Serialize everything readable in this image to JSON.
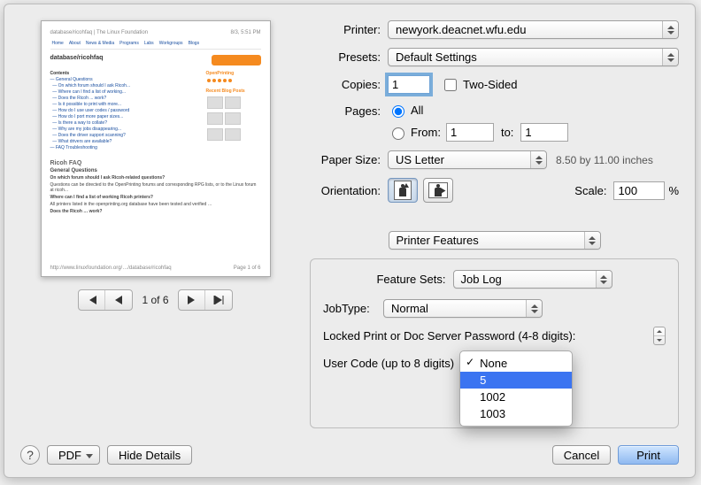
{
  "labels": {
    "printer": "Printer:",
    "presets": "Presets:",
    "copies": "Copies:",
    "two_sided": "Two-Sided",
    "pages": "Pages:",
    "all": "All",
    "from": "From:",
    "to": "to:",
    "paper_size": "Paper Size:",
    "orientation": "Orientation:",
    "scale": "Scale:",
    "feature_sets": "Feature Sets:",
    "job_type": "JobType:",
    "locked_pw": "Locked Print or Doc Server Password (4-8 digits):",
    "user_code": "User Code (up to 8 digits)"
  },
  "values": {
    "printer": "newyork.deacnet.wfu.edu",
    "preset": "Default Settings",
    "copies": "1",
    "pages_from": "1",
    "pages_to": "1",
    "paper_size": "US Letter",
    "paper_dims": "8.50 by 11.00 inches",
    "scale": "100",
    "scale_unit": "%",
    "section": "Printer Features",
    "feature_set": "Job Log",
    "job_type": "Normal",
    "user_code_selected": "5"
  },
  "user_code_menu": {
    "items": [
      "None",
      "5",
      "1002",
      "1003"
    ],
    "checked": "None",
    "highlighted": "5"
  },
  "pager": {
    "label": "1 of 6"
  },
  "footer": {
    "pdf": "PDF",
    "hide_details": "Hide Details",
    "cancel": "Cancel",
    "print": "Print"
  },
  "preview": {
    "left_header": "database/ricohfaq  |  The Linux Foundation",
    "right_header": "8/3, 5:51 PM",
    "crumb": "database/ricohfaq",
    "contents_h": "Contents",
    "side1": "OpenPrinting",
    "side2": "Recent Blog Posts",
    "faq_h": "Ricoh FAQ",
    "gen_h": "General Questions",
    "q1": "On which forum should I ask Ricoh-related questions?",
    "q2": "Where can I find a list of working Ricoh printers?",
    "q3": "Does the Ricoh … work?",
    "foot_l": "http://www.linuxfoundation.org/…/database/ricohfaq",
    "foot_r": "Page 1 of 6"
  }
}
